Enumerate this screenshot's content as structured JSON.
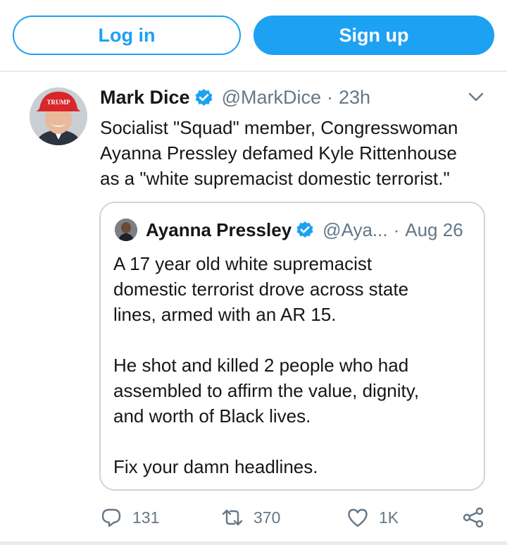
{
  "auth": {
    "login_label": "Log in",
    "signup_label": "Sign up"
  },
  "tweet": {
    "author_name": "Mark Dice",
    "handle": "@MarkDice",
    "separator": "·",
    "time": "23h",
    "avatar_hat_text": "TRUMP",
    "text_lines": [
      "Socialist \"Squad\" member, Congresswoman",
      "Ayanna Pressley defamed Kyle Rittenhouse",
      "as a \"white supremacist domestic terrorist.\""
    ],
    "quoted": {
      "author_name": "Ayanna Pressley",
      "handle": "@Aya...",
      "separator": "·",
      "date": "Aug 26",
      "text_lines": [
        "A 17 year old white supremacist",
        "domestic terrorist drove across state",
        "lines, armed with an AR 15.",
        "",
        "He shot and killed 2 people who had",
        "assembled to affirm the value, dignity,",
        "and worth of Black lives.",
        "",
        "Fix your damn headlines."
      ]
    },
    "actions": {
      "replies": "131",
      "retweets": "370",
      "likes": "1K"
    }
  },
  "colors": {
    "brand": "#1da1f2",
    "muted": "#657786",
    "border": "#ccd6dd",
    "divider": "#e6ecf0"
  }
}
